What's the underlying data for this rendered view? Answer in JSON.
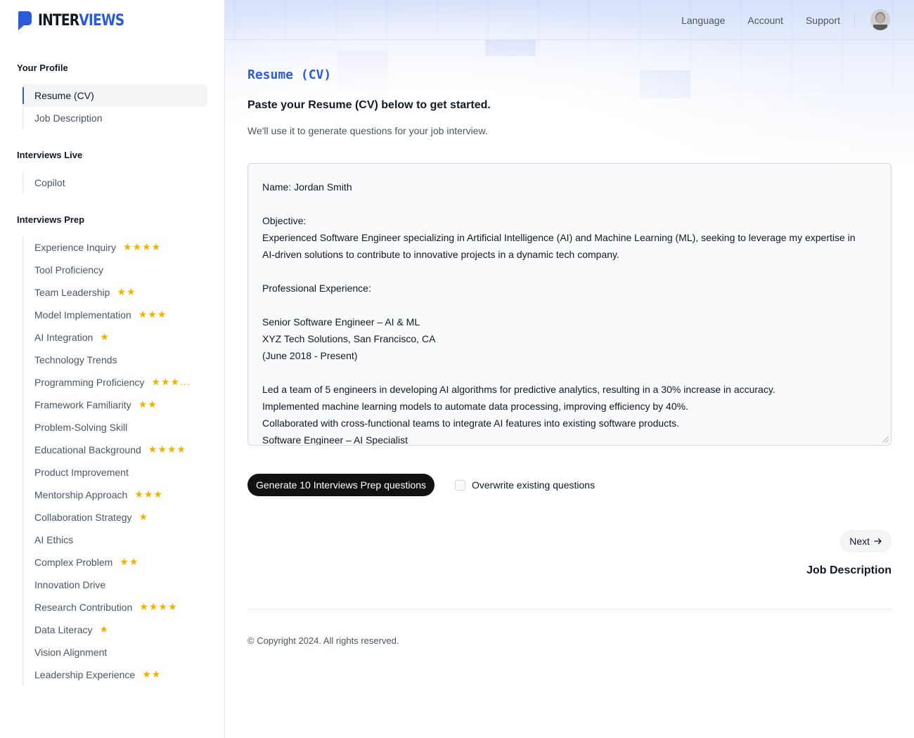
{
  "brand": {
    "name_part1": "INTER",
    "name_part2": "VIEWS"
  },
  "header": {
    "links": [
      "Language",
      "Account",
      "Support"
    ]
  },
  "sidebar": {
    "your_profile": {
      "title": "Your Profile",
      "items": [
        {
          "label": "Resume (CV)",
          "active": true
        },
        {
          "label": "Job Description"
        }
      ]
    },
    "interviews_live": {
      "title": "Interviews Live",
      "items": [
        {
          "label": "Copilot"
        }
      ]
    },
    "interviews_prep": {
      "title": "Interviews Prep",
      "items": [
        {
          "label": "Experience Inquiry",
          "stars": "★★★★"
        },
        {
          "label": "Tool Proficiency",
          "stars": ""
        },
        {
          "label": "Team Leadership",
          "stars": "★★"
        },
        {
          "label": "Model Implementation",
          "stars": "★★★"
        },
        {
          "label": "AI Integration",
          "stars": "★"
        },
        {
          "label": "Technology Trends",
          "stars": ""
        },
        {
          "label": "Programming Proficiency",
          "stars": "★★★…"
        },
        {
          "label": "Framework Familiarity",
          "stars": "★★"
        },
        {
          "label": "Problem-Solving Skill",
          "stars": ""
        },
        {
          "label": "Educational Background",
          "stars": "★★★★"
        },
        {
          "label": "Product Improvement",
          "stars": ""
        },
        {
          "label": "Mentorship Approach",
          "stars": "★★★"
        },
        {
          "label": "Collaboration Strategy",
          "stars": "★"
        },
        {
          "label": "AI Ethics",
          "stars": ""
        },
        {
          "label": "Complex Problem",
          "stars": "★★"
        },
        {
          "label": "Innovation Drive",
          "stars": ""
        },
        {
          "label": "Research Contribution",
          "stars": "★★★★"
        },
        {
          "label": "Data Literacy",
          "stars": "★"
        },
        {
          "label": "Vision Alignment",
          "stars": ""
        },
        {
          "label": "Leadership Experience",
          "stars": "★★"
        }
      ]
    }
  },
  "main": {
    "title": "Resume (CV)",
    "subtitle": "Paste your Resume (CV) below to get started.",
    "description": "We'll use it to generate questions for your job interview.",
    "resume_lines": [
      "Name: Jordan Smith",
      "",
      "Objective:",
      "Experienced Software Engineer specializing in Artificial Intelligence (AI) and Machine Learning (ML), seeking to leverage my expertise in",
      "AI-driven solutions to contribute to innovative projects in a dynamic tech company.",
      "",
      "Professional Experience:",
      "",
      "Senior Software Engineer – AI & ML",
      "XYZ Tech Solutions, San Francisco, CA",
      "(June 2018 - Present)",
      "",
      "Led a team of 5 engineers in developing AI algorithms for predictive analytics, resulting in a 30% increase in accuracy.",
      "Implemented machine learning models to automate data processing, improving efficiency by 40%.",
      "Collaborated with cross-functional teams to integrate AI features into existing software products.",
      "Software Engineer – AI Specialist"
    ],
    "generate_button": "Generate 10 Interviews Prep questions",
    "overwrite_label": "Overwrite existing questions",
    "next_label": "Next",
    "next_target": "Job Description",
    "copyright": "© Copyright 2024. All rights reserved."
  }
}
